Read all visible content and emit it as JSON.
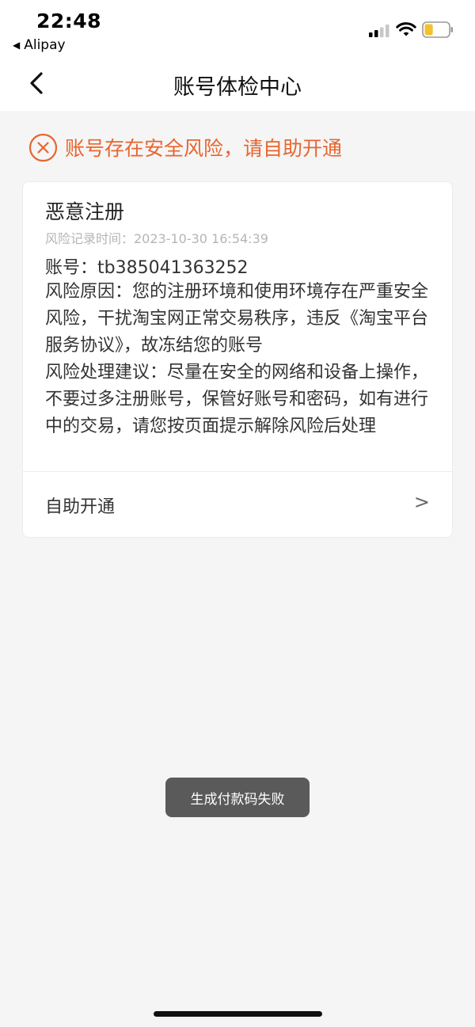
{
  "status_bar": {
    "time": "22:48",
    "back_app": "Alipay",
    "icons": [
      "signal-icon",
      "wifi-icon",
      "battery-icon"
    ],
    "battery_level": 0.35,
    "battery_color": "#f2c12e"
  },
  "nav": {
    "title": "账号体检中心",
    "back_icon": "chevron-left-icon"
  },
  "alert": {
    "icon": "close-circle-icon",
    "text": "账号存在安全风险，请自助开通",
    "color": "#e8652e"
  },
  "risk_card": {
    "title": "恶意注册",
    "record_time": "风险记录时间：2023-10-30 16:54:39",
    "account": "账号：tb385041363252",
    "reason": "风险原因：您的注册环境和使用环境存在严重安全风险，干扰淘宝网正常交易秩序，违反《淘宝平台服务协议》，故冻结您的账号",
    "suggestion": "风险处理建议：尽量在安全的网络和设备上操作，不要过多注册账号，保管好账号和密码，如有进行中的交易，请您按页面提示解除风险后处理",
    "action_label": "自助开通",
    "action_arrow": ">"
  },
  "toast": {
    "text": "生成付款码失败"
  }
}
